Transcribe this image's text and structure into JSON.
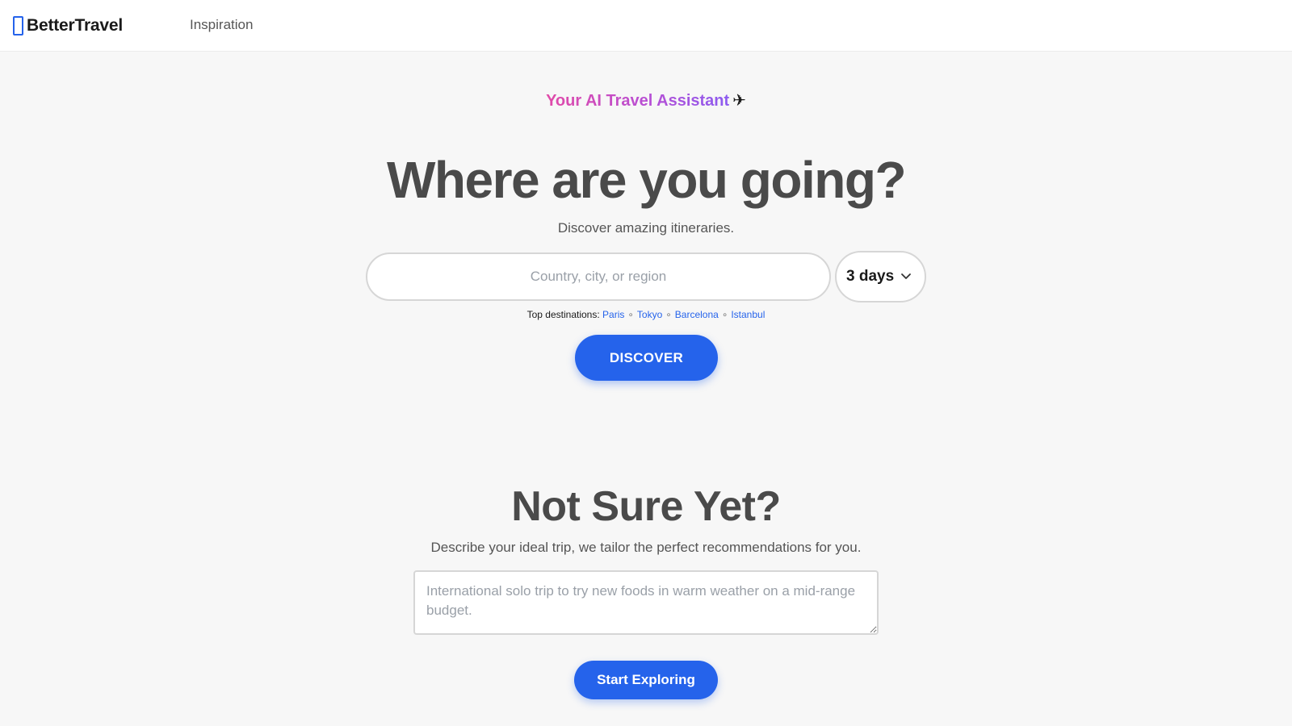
{
  "header": {
    "brand_name": "BetterTravel",
    "brand_icon": "brand-logo-icon",
    "nav": [
      {
        "label": "Inspiration"
      }
    ]
  },
  "hero": {
    "tagline": "Your AI Travel Assistant",
    "tagline_emoji": "✈",
    "title": "Where are you going?",
    "subtitle": "Discover amazing itineraries.",
    "search": {
      "placeholder": "Country, city, or region",
      "value": ""
    },
    "duration": {
      "selected": "3 days",
      "icon": "chevron-down-icon"
    },
    "top_destinations": {
      "label": "Top destinations:",
      "separator": "∘",
      "items": [
        "Paris",
        "Tokyo",
        "Barcelona",
        "Istanbul"
      ]
    },
    "discover_label": "DISCOVER"
  },
  "recommend": {
    "title": "Not Sure Yet?",
    "subtitle": "Describe your ideal trip, we tailor the perfect recommendations for you.",
    "textarea": {
      "placeholder": "International solo trip to try new foods in warm weather on a mid-range budget.",
      "value": ""
    },
    "button_label": "Start Exploring"
  },
  "colors": {
    "accent": "#2563eb",
    "background": "#f7f7f7",
    "heading": "#4a4a4a",
    "tagline_gradient": [
      "#e14aa8",
      "#8c5cf0"
    ]
  }
}
